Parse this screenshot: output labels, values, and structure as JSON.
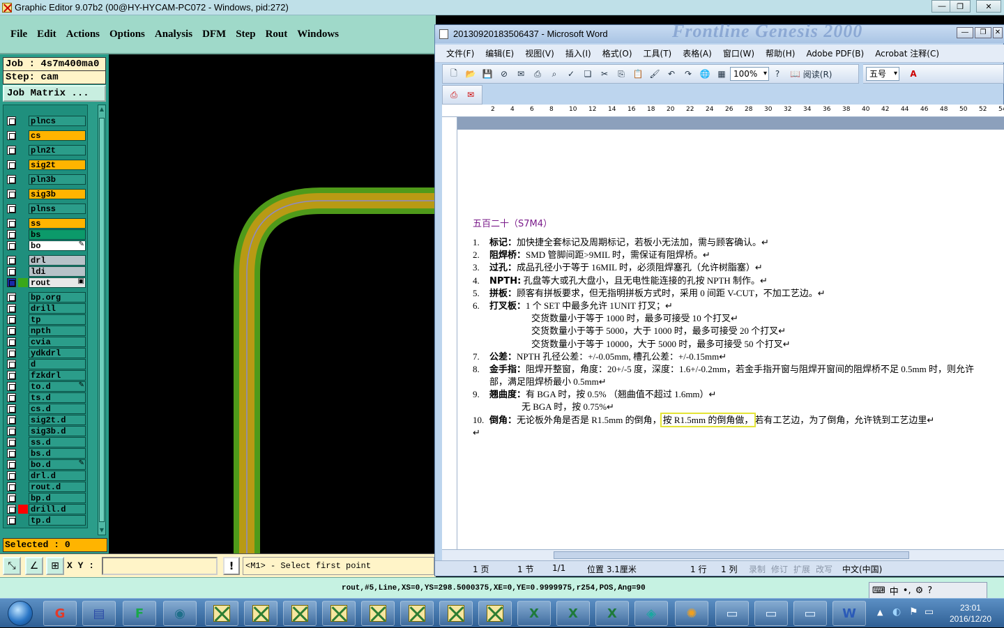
{
  "ge": {
    "title": "Graphic Editor 9.07b2 (00@HY-HYCAM-PC072 - Windows, pid:272)",
    "menu": [
      {
        "label": "File"
      },
      {
        "label": "Edit"
      },
      {
        "label": "Actions"
      },
      {
        "label": "Options"
      },
      {
        "label": "Analysis"
      },
      {
        "label": "DFM"
      },
      {
        "label": "Step"
      },
      {
        "label": "Rout"
      },
      {
        "label": "Windows"
      }
    ],
    "job_label": "Job : 4s7m400ma0",
    "step_label": "Step: cam",
    "job_matrix": "Job Matrix ...",
    "layers": [
      {
        "name": "plncs",
        "color": "#2b9d8a"
      },
      {
        "name": "cs",
        "color": "#ffb400"
      },
      {
        "name": "pln2t",
        "color": "#2b9d8a"
      },
      {
        "name": "sig2t",
        "color": "#ffb400"
      },
      {
        "name": "pln3b",
        "color": "#2b9d8a"
      },
      {
        "name": "sig3b",
        "color": "#ffb400"
      },
      {
        "name": "plnss",
        "color": "#2b9d8a"
      },
      {
        "name": "ss",
        "color": "#ffb400"
      },
      {
        "name": "bs",
        "color": "#0c9a6a"
      },
      {
        "name": "bo",
        "color": "#ffffff",
        "mark": "✎"
      },
      {
        "name": "drl",
        "color": "#b7c2c8"
      },
      {
        "name": "ldi",
        "color": "#b7c2c8"
      },
      {
        "name": "rout",
        "color": "#e8e8e8",
        "mark": "▣",
        "active": true
      },
      {
        "name": "bp.org",
        "color": "#2b9d8a"
      },
      {
        "name": "drill",
        "color": "#2b9d8a"
      },
      {
        "name": "tp",
        "color": "#2b9d8a"
      },
      {
        "name": "npth",
        "color": "#2b9d8a"
      },
      {
        "name": "cvia",
        "color": "#2b9d8a"
      },
      {
        "name": "ydkdrl",
        "color": "#2b9d8a"
      },
      {
        "name": "d",
        "color": "#2b9d8a"
      },
      {
        "name": "fzkdrl",
        "color": "#2b9d8a"
      },
      {
        "name": "to.d",
        "color": "#2b9d8a",
        "mark": "✎"
      },
      {
        "name": "ts.d",
        "color": "#2b9d8a"
      },
      {
        "name": "cs.d",
        "color": "#2b9d8a"
      },
      {
        "name": "sig2t.d",
        "color": "#2b9d8a"
      },
      {
        "name": "sig3b.d",
        "color": "#2b9d8a"
      },
      {
        "name": "ss.d",
        "color": "#2b9d8a"
      },
      {
        "name": "bs.d",
        "color": "#2b9d8a"
      },
      {
        "name": "bo.d",
        "color": "#2b9d8a",
        "mark": "✎"
      },
      {
        "name": "drl.d",
        "color": "#2b9d8a"
      },
      {
        "name": "rout.d",
        "color": "#2b9d8a"
      },
      {
        "name": "bp.d",
        "color": "#2b9d8a"
      },
      {
        "name": "drill.d",
        "color": "#2b9d8a",
        "swatch": "#ff0000"
      },
      {
        "name": "tp.d",
        "color": "#2b9d8a"
      }
    ],
    "selected": "Selected : 0",
    "xy_label": "X Y :",
    "xy_value": "",
    "prompt": "<M1> - Select first point",
    "status": "rout,#5,Line,XS=0,YS=298.5000375,XE=0,YE=0.9999975,r254,POS,Ang=90",
    "colors": {
      "outer": "#4f9a1a",
      "inner": "#b89a14",
      "line": "#8c8ac8"
    }
  },
  "word": {
    "title": "20130920183506437 - Microsoft Word",
    "ghost_title": "Frontline  Genesis 2000",
    "menu": [
      {
        "label": "文件(F)"
      },
      {
        "label": "编辑(E)"
      },
      {
        "label": "视图(V)"
      },
      {
        "label": "插入(I)"
      },
      {
        "label": "格式(O)"
      },
      {
        "label": "工具(T)"
      },
      {
        "label": "表格(A)"
      },
      {
        "label": "窗口(W)"
      },
      {
        "label": "帮助(H)"
      },
      {
        "label": "Adobe PDF(B)"
      },
      {
        "label": "Acrobat 注释(C)"
      }
    ],
    "zoom": "100%",
    "reading": "阅读(R)",
    "font_size": "五号",
    "ruler_numbers": [
      "2",
      "4",
      "6",
      "8",
      "10",
      "12",
      "14",
      "16",
      "18",
      "20",
      "22",
      "24",
      "26",
      "28",
      "30",
      "32",
      "34",
      "36",
      "38",
      "40",
      "42",
      "44",
      "46",
      "48",
      "50",
      "52",
      "54"
    ],
    "heading": "五百二十（S7M4）",
    "lines": [
      {
        "num": "1.",
        "bold": "标记：",
        "text": "加快捷全套标记及周期标记，若板小无法加，需与顾客确认。↵"
      },
      {
        "num": "2.",
        "bold": "阻焊桥：",
        "text": "SMD 管脚间距>9MIL 时，需保证有阻焊桥。↵"
      },
      {
        "num": "3.",
        "bold": "过孔：",
        "text": "成品孔径小于等于 16MIL 时，必须阻焊塞孔（允许树脂塞）↵"
      },
      {
        "num": "4.",
        "bold": "NPTH:",
        "text": " 孔盘等大或孔大盘小，且无电性能连接的孔按 NPTH 制作。↵"
      },
      {
        "num": "5.",
        "bold": "拼板：",
        "text": "顾客有拼板要求，但无指明拼板方式时，采用 0 间距 V-CUT，不加工艺边。↵"
      },
      {
        "num": "6.",
        "bold": "打叉板：",
        "text": "1 个 SET 中最多允许 1UNIT 打叉；↵"
      },
      {
        "indent": true,
        "text": "交货数量小于等于 1000 时，最多可接受 10 个打叉↵"
      },
      {
        "indent": true,
        "text": "交货数量小于等于 5000，大于 1000 时，最多可接受 20 个打叉↵"
      },
      {
        "indent": true,
        "text": "交货数量小于等于 10000，大于 5000 时，最多可接受 50 个打叉↵"
      },
      {
        "num": "7.",
        "bold": "公差：",
        "text": "NPTH 孔径公差：+/-0.05mm,       槽孔公差：+/-0.15mm↵"
      },
      {
        "num": "8.",
        "bold": "金手指：",
        "text": "阻焊开整窗，角度：20+/-5 度，深度：1.6+/-0.2mm，若金手指开窗与阻焊开窗间的阻焊桥不足 0.5mm 时，则允许"
      },
      {
        "cont": true,
        "text": "部，满足阻焊桥最小 0.5mm↵"
      },
      {
        "num": "9.",
        "bold": "翘曲度：",
        "text": "有 BGA 时，按 0.5%   （翘曲值不超过 1.6mm）↵"
      },
      {
        "indent2": true,
        "text": "无 BGA 时，按 0.75%↵"
      },
      {
        "num": "10.",
        "bold": "倒角：",
        "text": "无论板外角是否是 R1.5mm 的倒角，",
        "hl": "按 R1.5mm 的倒角做，",
        "after": "若有工艺边，为了倒角，允许铣到工艺边里↵"
      },
      {
        "text": "↵"
      }
    ],
    "status": {
      "page": "1 页",
      "section": "1 节",
      "pages": "1/1",
      "position": "位置 3.1厘米",
      "line": "1 行",
      "col": "1 列",
      "rec": "录制",
      "rev": "修订",
      "ext": "扩展",
      "ovr": "改写",
      "lang": "中文(中国)"
    }
  },
  "taskbar": {
    "time": "23:01",
    "date": "2016/12/20",
    "ime": "中"
  }
}
